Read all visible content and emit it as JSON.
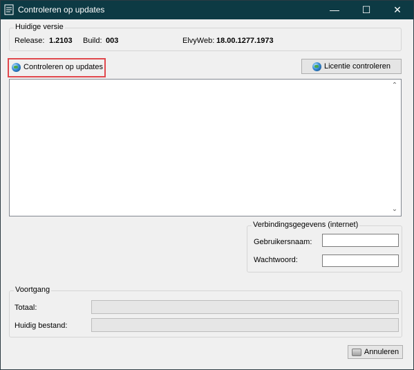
{
  "window": {
    "title": "Controleren op updates"
  },
  "titlebar": {
    "minimize": "—",
    "maximize": "☐",
    "close": "✕"
  },
  "version_group": {
    "legend": "Huidige versie",
    "release_label": "Release:",
    "release_value": "1.2103",
    "build_label": "Build:",
    "build_value": "003",
    "elvyweb_label": "ElvyWeb:",
    "elvyweb_value": "18.00.1277.1973"
  },
  "toolbar": {
    "check_updates_label": "Controleren op updates",
    "check_license_label": "Licentie controleren"
  },
  "log": {
    "scroll_up": "⌃",
    "scroll_down": "⌄"
  },
  "connection_group": {
    "legend": "Verbindingsgegevens (internet)",
    "username_label": "Gebruikersnaam:",
    "username_value": "",
    "password_label": "Wachtwoord:",
    "password_value": ""
  },
  "progress_group": {
    "legend": "Voortgang",
    "total_label": "Totaal:",
    "total_progress": 0,
    "current_label": "Huidig bestand:",
    "current_progress": 0
  },
  "footer": {
    "cancel_label": "Annuleren"
  },
  "icons": {
    "app": "document-icon",
    "globe": "globe-icon",
    "cancel": "cancel-icon"
  },
  "colors": {
    "titlebar": "#0d3a44",
    "highlight": "#e0474c"
  }
}
